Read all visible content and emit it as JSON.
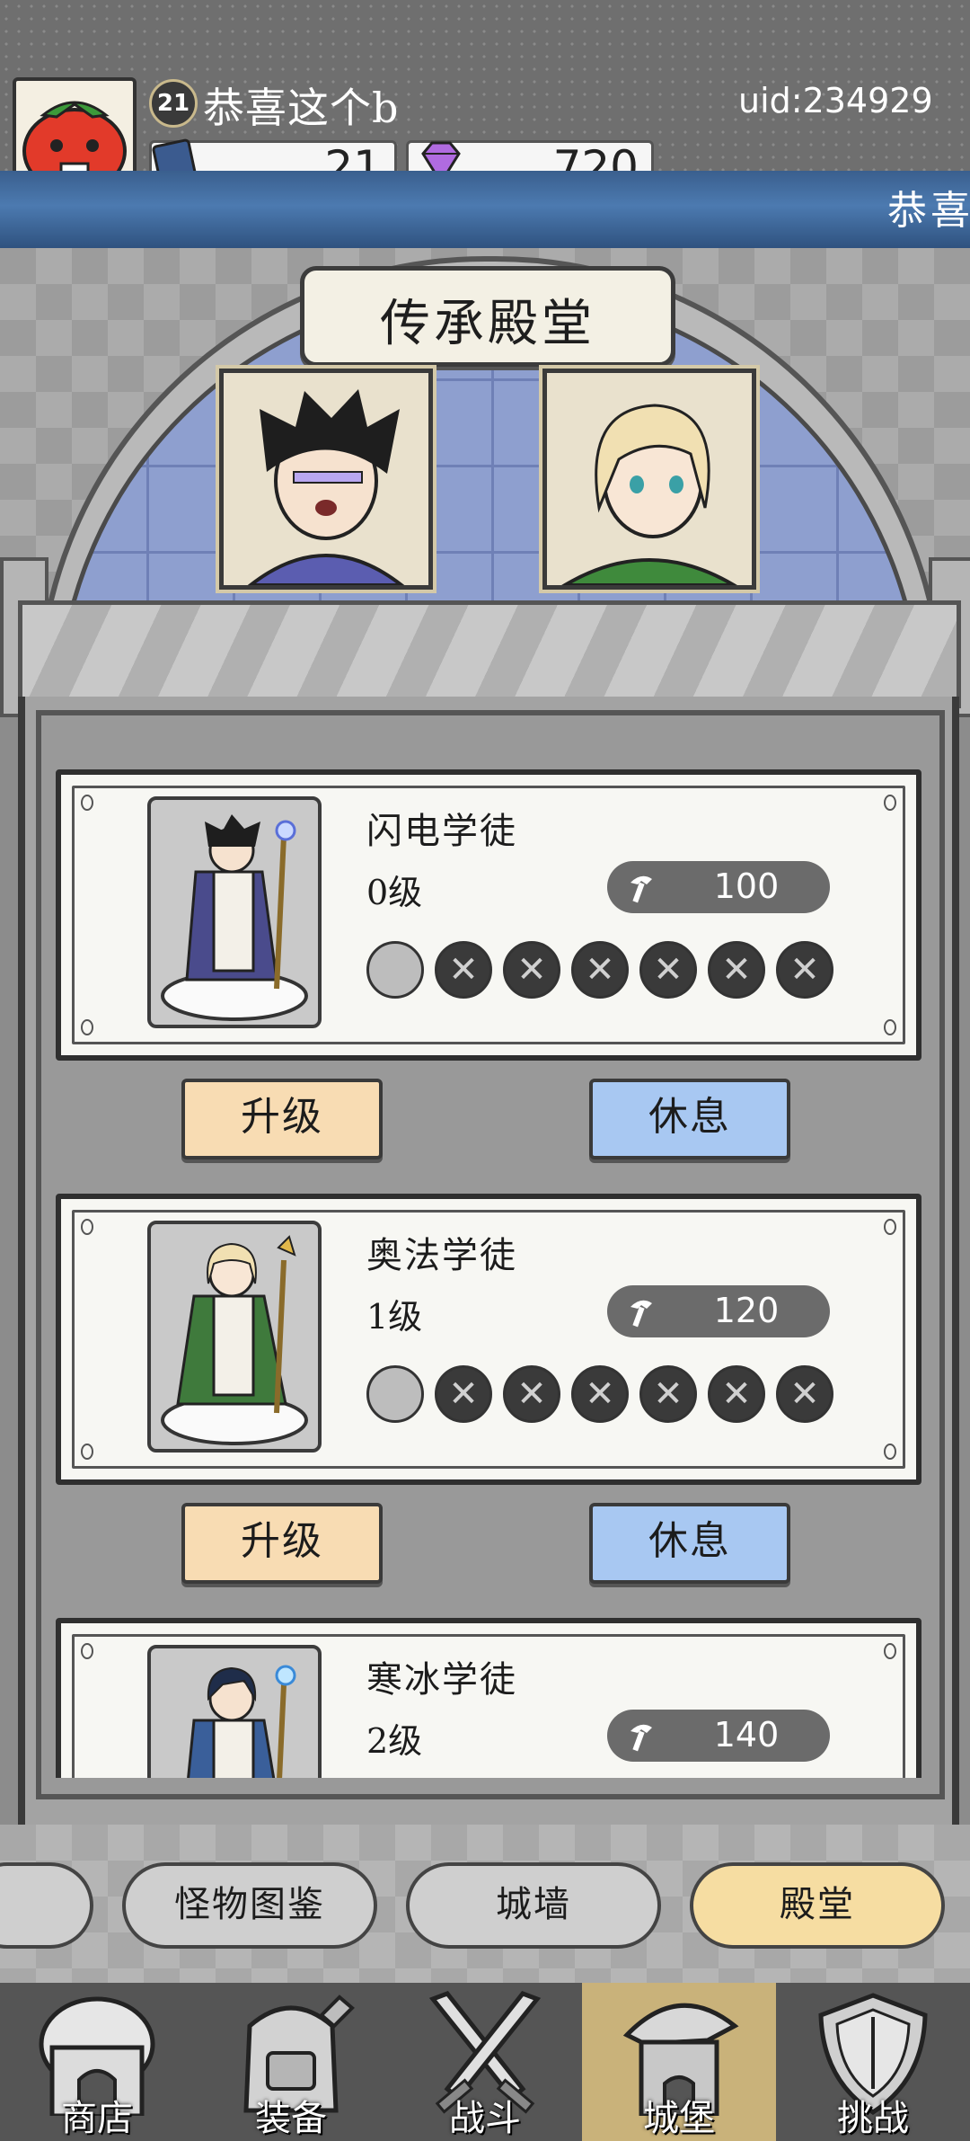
{
  "header": {
    "level": "21",
    "player_name": "恭喜这个b",
    "uid": "uid:234929",
    "currency_cards": "21",
    "currency_gems": "720",
    "marquee": "恭喜"
  },
  "hall": {
    "title": "传承殿堂"
  },
  "apprentices": [
    {
      "name": "闪电学徒",
      "level": "0级",
      "cost": "100",
      "upgrade_label": "升级",
      "rest_label": "休息",
      "robe": "#4a4b8c"
    },
    {
      "name": "奥法学徒",
      "level": "1级",
      "cost": "120",
      "upgrade_label": "升级",
      "rest_label": "休息",
      "robe": "#3f7a3c"
    },
    {
      "name": "寒冰学徒",
      "level": "2级",
      "cost": "140",
      "robe": "#3a5f9a"
    }
  ],
  "sub_tabs": [
    {
      "label": "怪物图鉴",
      "active": false
    },
    {
      "label": "城墙",
      "active": false
    },
    {
      "label": "殿堂",
      "active": true
    }
  ],
  "nav": [
    {
      "label": "商店",
      "icon": "shop-icon"
    },
    {
      "label": "装备",
      "icon": "backpack-icon"
    },
    {
      "label": "战斗",
      "icon": "crossed-swords-icon"
    },
    {
      "label": "城堡",
      "icon": "castle-icon"
    },
    {
      "label": "挑战",
      "icon": "shield-icon"
    }
  ],
  "colors": {
    "upgrade_button": "#f8dcb3",
    "rest_button": "#a8c8f2",
    "active_tab": "#f6dda2",
    "banner": "#3a5f8e"
  }
}
